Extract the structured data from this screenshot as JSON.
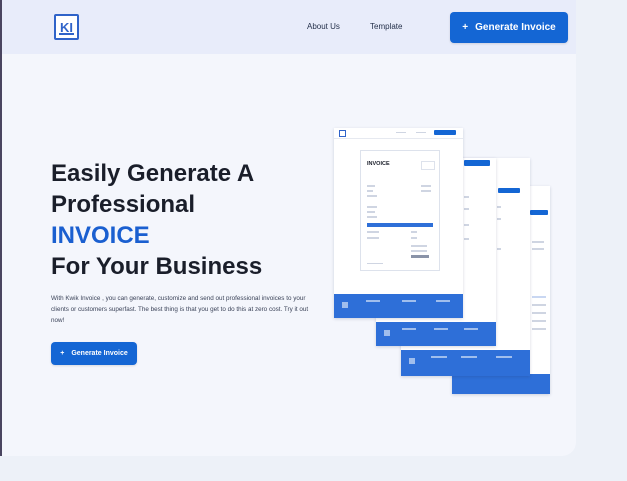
{
  "app": {
    "logo_text": "KI"
  },
  "nav": {
    "links": [
      "About Us",
      "Template"
    ],
    "cta_label": "Generate Invoice"
  },
  "hero": {
    "headline_line1": "Easily Generate A",
    "headline_line2": "Professional",
    "headline_accent": "INVOICE",
    "headline_line4": "For Your Business",
    "description": "With Kwik Invoice , you can generate, customize and send out professional invoices to your clients or customers superfast. The best thing is that you get to do this at zero cost. Try it out now!",
    "cta_label": "Generate Invoice"
  },
  "mockup": {
    "invoice_title": "INVOICE"
  },
  "colors": {
    "accent": "#1466d4",
    "headline_accent": "#1a5fd0",
    "nav_bg": "#e8ecfa",
    "page_bg": "#f4f6fc"
  },
  "icons": {
    "plus": "plus-icon",
    "logo": "kwik-invoice-logo"
  }
}
